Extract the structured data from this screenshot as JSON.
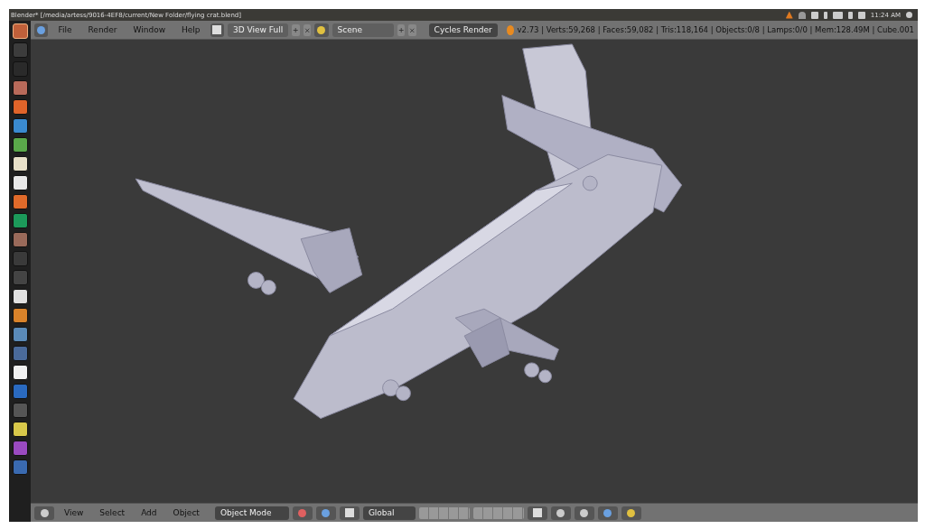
{
  "window": {
    "title": "Blender* [/media/artess/9016-4EF8/current/New Folder/flying crat.blend]"
  },
  "system_tray": {
    "time": "11:24 AM"
  },
  "launcher": {
    "items": [
      {
        "color": "#c0603a",
        "selected": true
      },
      {
        "color": "#3c3c3c",
        "selected": false
      },
      {
        "color": "#2a2a2a",
        "selected": false
      },
      {
        "color": "#b86a5a",
        "selected": false
      },
      {
        "color": "#e0642a",
        "selected": false
      },
      {
        "color": "#3a8ad0",
        "selected": false
      },
      {
        "color": "#5aa84a",
        "selected": false
      },
      {
        "color": "#e8e0c8",
        "selected": false
      },
      {
        "color": "#e8e8e8",
        "selected": false
      },
      {
        "color": "#e06a2a",
        "selected": false
      },
      {
        "color": "#1c9a5a",
        "selected": false
      },
      {
        "color": "#9a6a5a",
        "selected": false
      },
      {
        "color": "#3a3a3a",
        "selected": false
      },
      {
        "color": "#444444",
        "selected": false
      },
      {
        "color": "#e0e0e0",
        "selected": false
      },
      {
        "color": "#d8822a",
        "selected": false
      },
      {
        "color": "#5a8ab8",
        "selected": false
      },
      {
        "color": "#4a6a9a",
        "selected": false
      },
      {
        "color": "#f0f0f0",
        "selected": false
      },
      {
        "color": "#2a6ac0",
        "selected": false
      },
      {
        "color": "#555555",
        "selected": false
      },
      {
        "color": "#d8c84a",
        "selected": false
      },
      {
        "color": "#9a4ac0",
        "selected": false
      },
      {
        "color": "#3a6ab0",
        "selected": false
      }
    ]
  },
  "info_header": {
    "menus": [
      "File",
      "Render",
      "Window",
      "Help"
    ],
    "layout": "3D View Full",
    "scene": "Scene",
    "engine": "Cycles Render",
    "stats": "v2.73 | Verts:59,268 | Faces:59,082 | Tris:118,164 | Objects:0/8 | Lamps:0/0 | Mem:128.49M | Cube.001"
  },
  "view3d_header": {
    "menus": [
      "View",
      "Select",
      "Add",
      "Object"
    ],
    "mode": "Object Mode",
    "orientation": "Global"
  }
}
